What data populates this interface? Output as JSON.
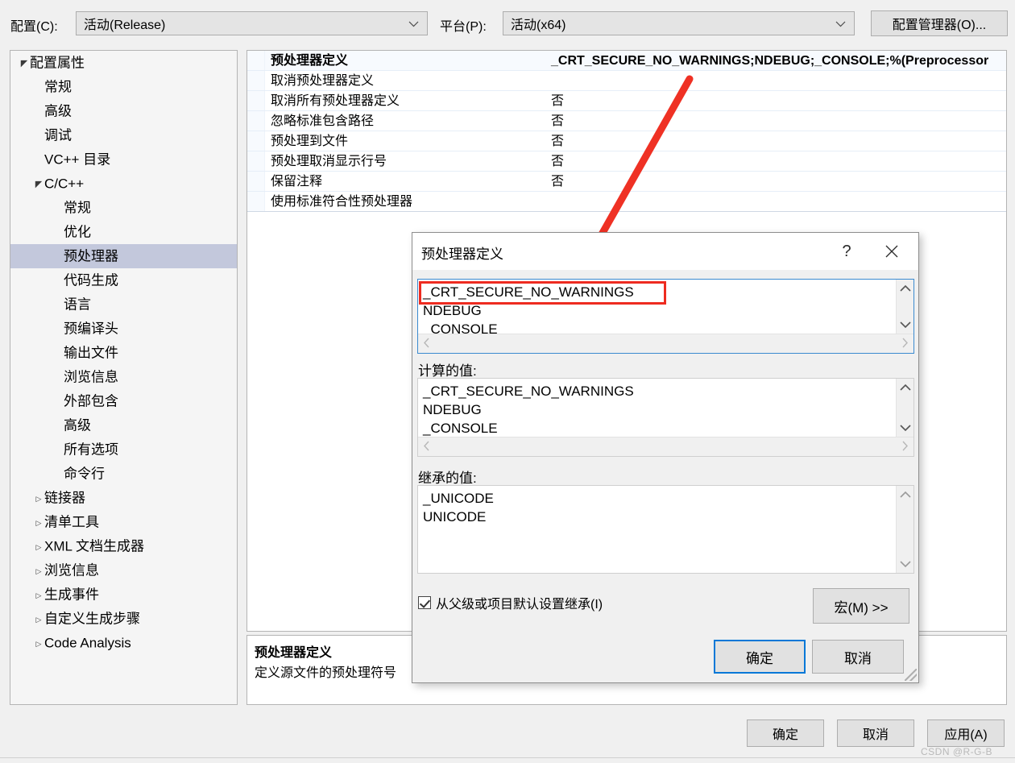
{
  "topbar": {
    "config_label": "配置(C):",
    "config_value": "活动(Release)",
    "platform_label": "平台(P):",
    "platform_value": "活动(x64)",
    "config_manager_button": "配置管理器(O)...",
    "dropdown_icon": "chevron-down-icon"
  },
  "tree": {
    "items": [
      {
        "label": "配置属性",
        "depth": 0,
        "twisty": "▲",
        "selected": false
      },
      {
        "label": "常规",
        "depth": 1,
        "twisty": "",
        "selected": false
      },
      {
        "label": "高级",
        "depth": 1,
        "twisty": "",
        "selected": false
      },
      {
        "label": "调试",
        "depth": 1,
        "twisty": "",
        "selected": false
      },
      {
        "label": "VC++ 目录",
        "depth": 1,
        "twisty": "",
        "selected": false
      },
      {
        "label": "C/C++",
        "depth": 1,
        "twisty": "▲",
        "selected": false
      },
      {
        "label": "常规",
        "depth": 2,
        "twisty": "",
        "selected": false
      },
      {
        "label": "优化",
        "depth": 2,
        "twisty": "",
        "selected": false
      },
      {
        "label": "预处理器",
        "depth": 2,
        "twisty": "",
        "selected": true
      },
      {
        "label": "代码生成",
        "depth": 2,
        "twisty": "",
        "selected": false
      },
      {
        "label": "语言",
        "depth": 2,
        "twisty": "",
        "selected": false
      },
      {
        "label": "预编译头",
        "depth": 2,
        "twisty": "",
        "selected": false
      },
      {
        "label": "输出文件",
        "depth": 2,
        "twisty": "",
        "selected": false
      },
      {
        "label": "浏览信息",
        "depth": 2,
        "twisty": "",
        "selected": false
      },
      {
        "label": "外部包含",
        "depth": 2,
        "twisty": "",
        "selected": false
      },
      {
        "label": "高级",
        "depth": 2,
        "twisty": "",
        "selected": false
      },
      {
        "label": "所有选项",
        "depth": 2,
        "twisty": "",
        "selected": false
      },
      {
        "label": "命令行",
        "depth": 2,
        "twisty": "",
        "selected": false
      },
      {
        "label": "链接器",
        "depth": 1,
        "twisty": "▶",
        "selected": false
      },
      {
        "label": "清单工具",
        "depth": 1,
        "twisty": "▶",
        "selected": false
      },
      {
        "label": "XML 文档生成器",
        "depth": 1,
        "twisty": "▶",
        "selected": false
      },
      {
        "label": "浏览信息",
        "depth": 1,
        "twisty": "▶",
        "selected": false
      },
      {
        "label": "生成事件",
        "depth": 1,
        "twisty": "▶",
        "selected": false
      },
      {
        "label": "自定义生成步骤",
        "depth": 1,
        "twisty": "▶",
        "selected": false
      },
      {
        "label": "Code Analysis",
        "depth": 1,
        "twisty": "▶",
        "selected": false
      }
    ]
  },
  "grid": {
    "rows": [
      {
        "name": "预处理器定义",
        "value": "_CRT_SECURE_NO_WARNINGS;NDEBUG;_CONSOLE;%(Preprocessor"
      },
      {
        "name": "取消预处理器定义",
        "value": ""
      },
      {
        "name": "取消所有预处理器定义",
        "value": "否"
      },
      {
        "name": "忽略标准包含路径",
        "value": "否"
      },
      {
        "name": "预处理到文件",
        "value": "否"
      },
      {
        "name": "预处理取消显示行号",
        "value": "否"
      },
      {
        "name": "保留注释",
        "value": "否"
      },
      {
        "name": "使用标准符合性预处理器",
        "value": ""
      }
    ]
  },
  "description": {
    "title": "预处理器定义",
    "body": "定义源文件的预处理符号"
  },
  "footer": {
    "ok": "确定",
    "cancel": "取消",
    "apply": "应用(A)",
    "watermark": "CSDN @R-G-B"
  },
  "modal": {
    "title": "预处理器定义",
    "help_icon": "question-mark-icon",
    "close_icon": "close-icon",
    "edit_lines": [
      "_CRT_SECURE_NO_WARNINGS",
      "NDEBUG",
      "_CONSOLE"
    ],
    "computed_label": "计算的值:",
    "computed_lines": [
      "_CRT_SECURE_NO_WARNINGS",
      "NDEBUG",
      "_CONSOLE"
    ],
    "inherited_label": "继承的值:",
    "inherited_lines": [
      "_UNICODE",
      "UNICODE"
    ],
    "inherit_checkbox_label": "从父级或项目默认设置继承(I)",
    "inherit_checked": true,
    "macro_button": "宏(M) >>",
    "ok": "确定",
    "cancel": "取消",
    "scroll_up_icon": "chevron-up-icon",
    "scroll_down_icon": "chevron-down-icon",
    "scroll_left_icon": "chevron-left-icon",
    "scroll_right_icon": "chevron-right-icon"
  },
  "annotation": {
    "arrow_color": "#ef3124",
    "highlight_color": "#ee2b20"
  }
}
